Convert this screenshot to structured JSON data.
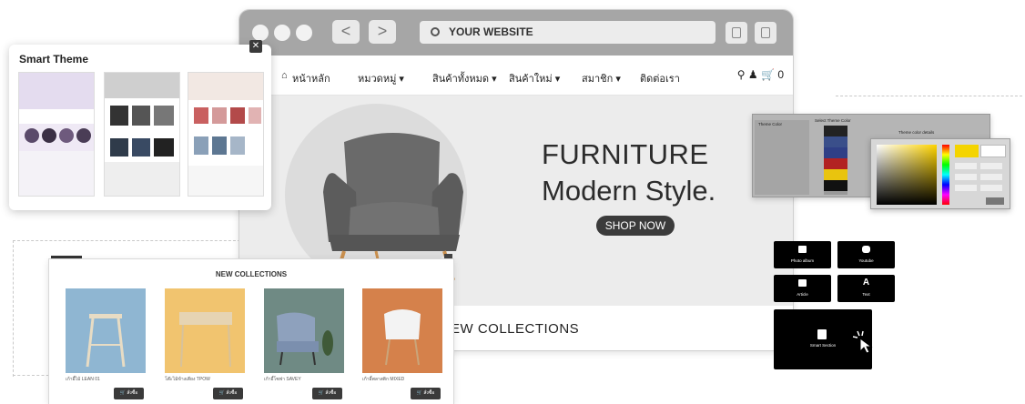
{
  "browser": {
    "url_text": "YOUR WEBSITE",
    "nav_back": "<",
    "nav_forward": ">"
  },
  "menu": {
    "items": [
      {
        "label": "หน้าหลัก",
        "icon": "home-icon"
      },
      {
        "label": "หมวดหมู่ ▾"
      },
      {
        "label": "สินค้าทั้งหมด ▾"
      },
      {
        "label": "สินค้าใหม่ ▾"
      },
      {
        "label": "สมาชิก ▾"
      },
      {
        "label": "ติดต่อเรา"
      }
    ],
    "cart_count": "0"
  },
  "hero": {
    "line1": "FURNITURE",
    "line2": "Modern Style.",
    "button": "SHOP NOW"
  },
  "collections_band": {
    "title": "EW COLLECTIONS"
  },
  "smart_theme": {
    "title": "Smart Theme",
    "close": "✕"
  },
  "new_collections": {
    "title": "NEW COLLECTIONS",
    "products": [
      {
        "name": "เก้าอี้ไม้ LEAN 01",
        "button": "สั่งซื้อ",
        "bg": "#8fb6d2"
      },
      {
        "name": "โต๊ะไม้ข้างเตียง TPOW",
        "button": "สั่งซื้อ",
        "bg": "#f1c46f"
      },
      {
        "name": "เก้าอี้โซฟา SAVEY",
        "button": "สั่งซื้อ",
        "bg": "#6f8a84"
      },
      {
        "name": "เก้าอี้พลาสติก MIXED",
        "button": "สั่งซื้อ",
        "bg": "#d5814b"
      }
    ]
  },
  "color_panel": {
    "left_label": "Theme Color",
    "mid_label": "Select Theme Color",
    "right_label": "Theme color details",
    "swatches": [
      "#222222",
      "#3a4f8a",
      "#2f3f86",
      "#b22222",
      "#e9c40e",
      "#111111"
    ]
  },
  "blocks": {
    "items": [
      {
        "label": "Photo album",
        "icon": "photo-icon"
      },
      {
        "label": "Youtube",
        "icon": "youtube-icon"
      },
      {
        "label": "Article",
        "icon": "article-icon"
      },
      {
        "label": "Text",
        "icon": "text-icon"
      }
    ],
    "smart_section": "Smart Section"
  }
}
